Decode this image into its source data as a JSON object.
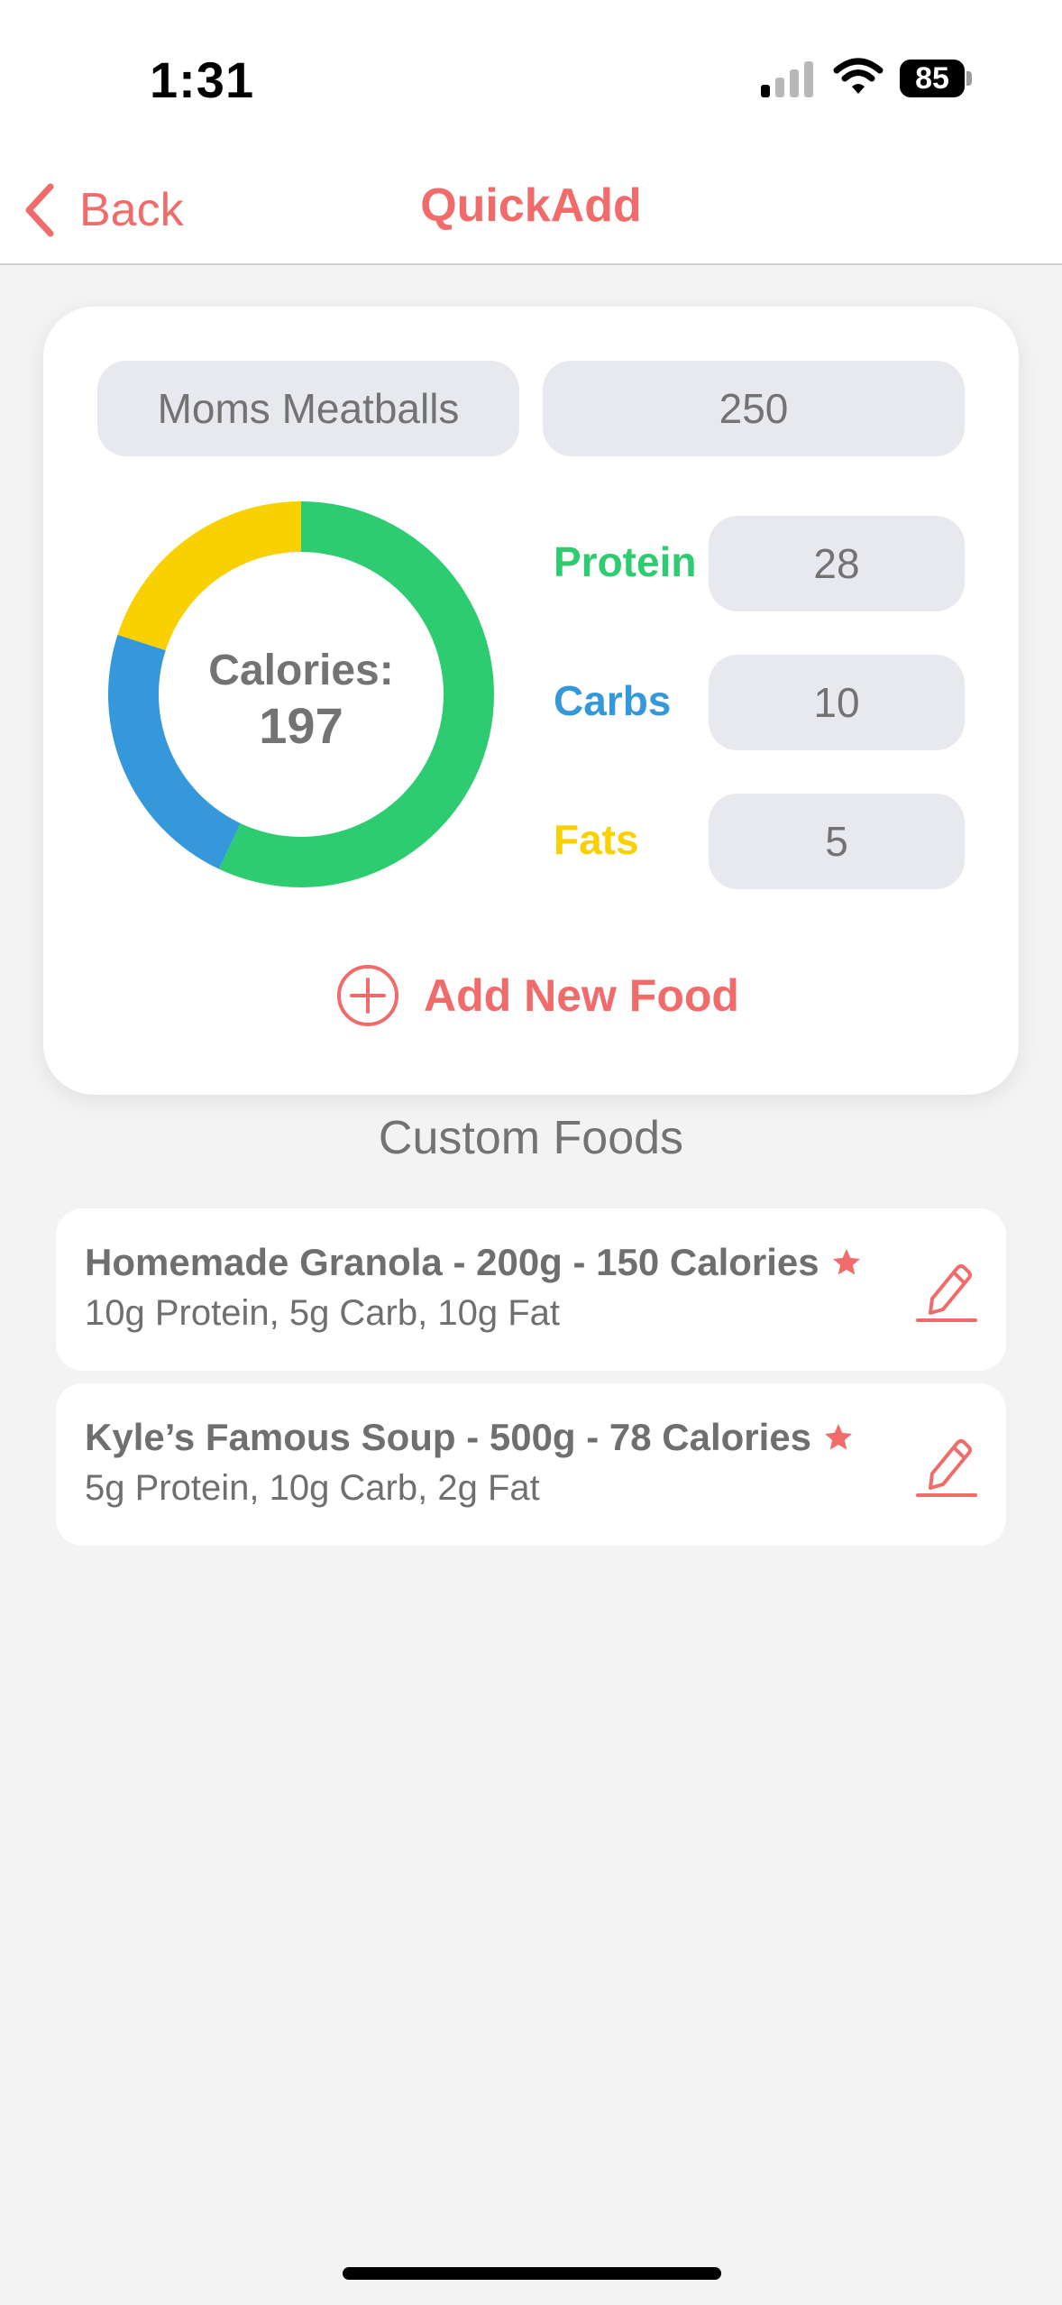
{
  "status_bar": {
    "time": "1:31",
    "battery": "85"
  },
  "nav": {
    "back_label": "Back",
    "title": "QuickAdd"
  },
  "form": {
    "food_name": "Moms Meatballs",
    "grams": "250",
    "calories_label": "Calories:",
    "calories_value": "197",
    "macros": {
      "protein": {
        "label": "Protein",
        "value": "28",
        "color": "#2ecc71"
      },
      "carbs": {
        "label": "Carbs",
        "value": "10",
        "color": "#3498db"
      },
      "fats": {
        "label": "Fats",
        "value": "5",
        "color": "#f9d000"
      }
    },
    "add_label": "Add New Food"
  },
  "chart_data": {
    "type": "pie",
    "categories": [
      "Protein",
      "Carbs",
      "Fats"
    ],
    "values": [
      0.57,
      0.23,
      0.2
    ],
    "colors": [
      "#2ecc71",
      "#3498db",
      "#f9d000"
    ]
  },
  "custom_foods": {
    "title": "Custom Foods",
    "items": [
      {
        "title": "Homemade Granola - 200g - 150 Calories",
        "subtitle": "10g Protein, 5g Carb, 10g Fat",
        "favorite": true
      },
      {
        "title": "Kyle’s Famous Soup - 500g - 78 Calories",
        "subtitle": "5g Protein, 10g Carb, 2g Fat",
        "favorite": true
      }
    ]
  },
  "theme": {
    "accent": "#f26b6b",
    "background": "#f3f3f3"
  }
}
